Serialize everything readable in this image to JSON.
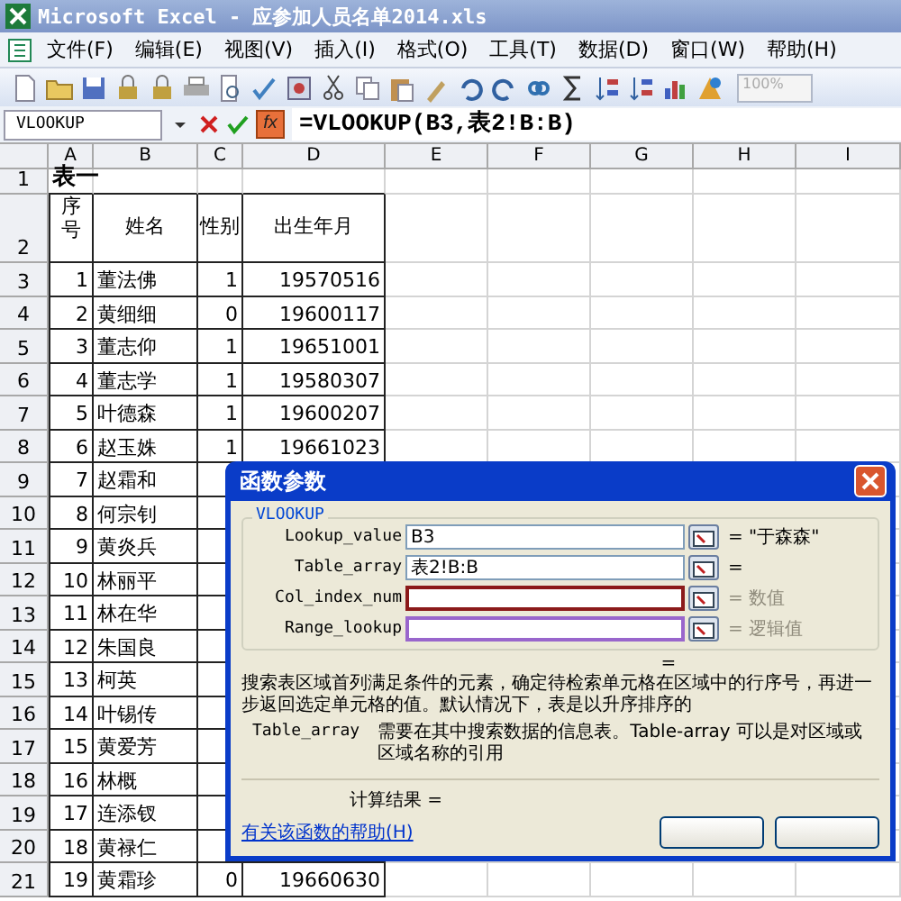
{
  "window": {
    "title": "Microsoft Excel - 应参加人员名单2014.xls"
  },
  "menu": [
    "文件(F)",
    "编辑(E)",
    "视图(V)",
    "插入(I)",
    "格式(O)",
    "工具(T)",
    "数据(D)",
    "窗口(W)",
    "帮助(H)"
  ],
  "toolbar": {
    "zoom": "100%"
  },
  "formula_bar": {
    "name_box": "VLOOKUP",
    "fx": "fx",
    "formula": "=VLOOKUP(B3,表2!B:B)"
  },
  "columns": [
    "A",
    "B",
    "C",
    "D",
    "E",
    "F",
    "G",
    "H",
    "I"
  ],
  "rows": [
    {
      "num": "1",
      "cells": [
        "表一"
      ]
    },
    {
      "num": "2",
      "cells": [
        "序号",
        "姓名",
        "性别",
        "出生年月"
      ]
    },
    {
      "num": "3",
      "cells": [
        "1",
        "董法佛",
        "1",
        "19570516"
      ]
    },
    {
      "num": "4",
      "cells": [
        "2",
        "黄细细",
        "0",
        "19600117"
      ]
    },
    {
      "num": "5",
      "cells": [
        "3",
        "董志仰",
        "1",
        "19651001"
      ]
    },
    {
      "num": "6",
      "cells": [
        "4",
        "董志学",
        "1",
        "19580307"
      ]
    },
    {
      "num": "7",
      "cells": [
        "5",
        "叶德森",
        "1",
        "19600207"
      ]
    },
    {
      "num": "8",
      "cells": [
        "6",
        "赵玉姝",
        "1",
        "19661023"
      ]
    },
    {
      "num": "9",
      "cells": [
        "7",
        "赵霜和"
      ]
    },
    {
      "num": "10",
      "cells": [
        "8",
        "何宗钊"
      ]
    },
    {
      "num": "11",
      "cells": [
        "9",
        "黄炎兵"
      ]
    },
    {
      "num": "12",
      "cells": [
        "10",
        "林丽平"
      ]
    },
    {
      "num": "13",
      "cells": [
        "11",
        "林在华"
      ]
    },
    {
      "num": "14",
      "cells": [
        "12",
        "朱国良"
      ]
    },
    {
      "num": "15",
      "cells": [
        "13",
        "柯英"
      ]
    },
    {
      "num": "16",
      "cells": [
        "14",
        "叶锡传"
      ]
    },
    {
      "num": "17",
      "cells": [
        "15",
        "黄爱芳"
      ]
    },
    {
      "num": "18",
      "cells": [
        "16",
        "林概"
      ]
    },
    {
      "num": "19",
      "cells": [
        "17",
        "连添钗"
      ]
    },
    {
      "num": "20",
      "cells": [
        "18",
        "黄禄仁"
      ]
    },
    {
      "num": "21",
      "cells": [
        "19",
        "黄霜珍",
        "0",
        "19660630"
      ]
    }
  ],
  "dialog": {
    "title": "函数参数",
    "function": "VLOOKUP",
    "args": [
      {
        "label": "Lookup_value",
        "value": "B3",
        "result": "= \"于森森\"",
        "color": "#7f9db9"
      },
      {
        "label": "Table_array",
        "value": "表2!B:B",
        "result": "=",
        "color": "#7f9db9"
      },
      {
        "label": "Col_index_num",
        "result": "= 数值",
        "color": "#8b1a1a"
      },
      {
        "label": "Range_lookup",
        "result": "= 逻辑值",
        "color": "#9966cc"
      }
    ],
    "total_result": "=",
    "description": "搜索表区域首列满足条件的元素，确定待检索单元格在区域中的行序号，再进一步返回选定单元格的值。默认情况下，表是以升序排序的",
    "param_name": "Table_array",
    "param_desc": "需要在其中搜索数据的信息表。Table-array 可以是对区域或区域名称的引用",
    "calc_label": "计算结果 =",
    "help_link": "有关该函数的帮助(H)"
  }
}
